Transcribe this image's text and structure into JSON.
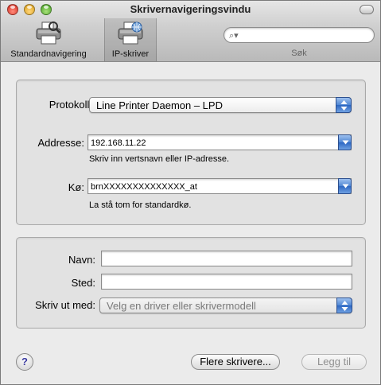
{
  "window": {
    "title": "Skrivernavigeringsvindu"
  },
  "toolbar": {
    "items": [
      {
        "label": "Standardnavigering",
        "icon": "printer-icon"
      },
      {
        "label": "IP-skriver",
        "icon": "network-printer-icon"
      }
    ],
    "search": {
      "label": "Søk",
      "value": ""
    }
  },
  "ip_group": {
    "protocol_label": "Protokoll:",
    "protocol_value": "Line Printer Daemon – LPD",
    "address_label": "Addresse:",
    "address_value": "192.168.11.22",
    "address_hint": "Skriv inn vertsnavn eller IP-adresse.",
    "queue_label": "Kø:",
    "queue_value": "brnXXXXXXXXXXXXXX_at",
    "queue_hint": "La stå tom for standardkø."
  },
  "info_group": {
    "name_label": "Navn:",
    "name_value": "",
    "location_label": "Sted:",
    "location_value": "",
    "printwith_label": "Skriv ut med:",
    "printwith_value": "Velg en driver eller skrivermodell"
  },
  "buttons": {
    "help": "?",
    "more_printers": "Flere skrivere...",
    "add": "Legg til"
  },
  "colors": {
    "accent_blue": "#4f86d4",
    "group_bg": "#e2e2e2",
    "window_bg": "#ebebeb"
  }
}
